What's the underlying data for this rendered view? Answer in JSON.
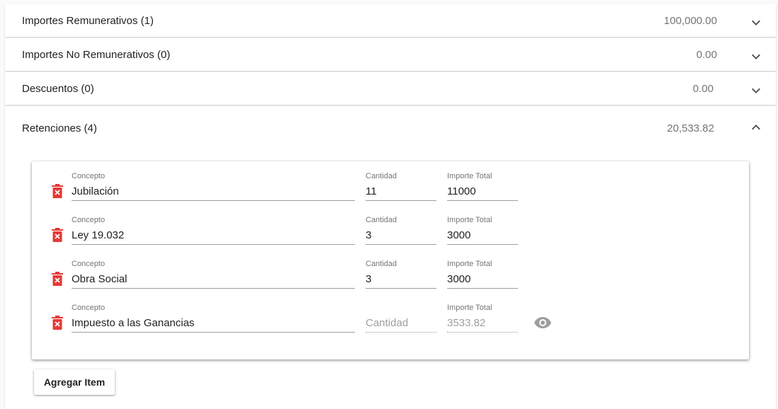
{
  "panels": [
    {
      "title": "Importes Remunerativos (1)",
      "amount": "100,000.00",
      "expanded": false
    },
    {
      "title": "Importes No Remunerativos (0)",
      "amount": "0.00",
      "expanded": false
    },
    {
      "title": "Descuentos (0)",
      "amount": "0.00",
      "expanded": false
    },
    {
      "title": "Retenciones (4)",
      "amount": "20,533.82",
      "expanded": true
    }
  ],
  "items": [
    {
      "concepto_label": "Concepto",
      "concepto": "Jubilación",
      "cantidad_label": "Cantidad",
      "cantidad": "11",
      "importe_label": "Importe Total",
      "importe": "11000"
    },
    {
      "concepto_label": "Concepto",
      "concepto": "Ley 19.032",
      "cantidad_label": "Cantidad",
      "cantidad": "3",
      "importe_label": "Importe Total",
      "importe": "3000"
    },
    {
      "concepto_label": "Concepto",
      "concepto": "Obra Social",
      "cantidad_label": "Cantidad",
      "cantidad": "3",
      "importe_label": "Importe Total",
      "importe": "3000"
    },
    {
      "concepto_label": "Concepto",
      "concepto": "Impuesto a las Ganancias",
      "cantidad_placeholder": "Cantidad",
      "importe_label": "Importe Total",
      "importe": "3533.82"
    }
  ],
  "add_button_label": "Agregar Item",
  "icons": {
    "delete": "delete-forever-icon",
    "expand": "chevron-down-icon",
    "collapse": "chevron-up-icon",
    "view": "eye-icon"
  },
  "colors": {
    "delete_icon": "#e53935",
    "eye_icon": "#9e9e9e"
  }
}
